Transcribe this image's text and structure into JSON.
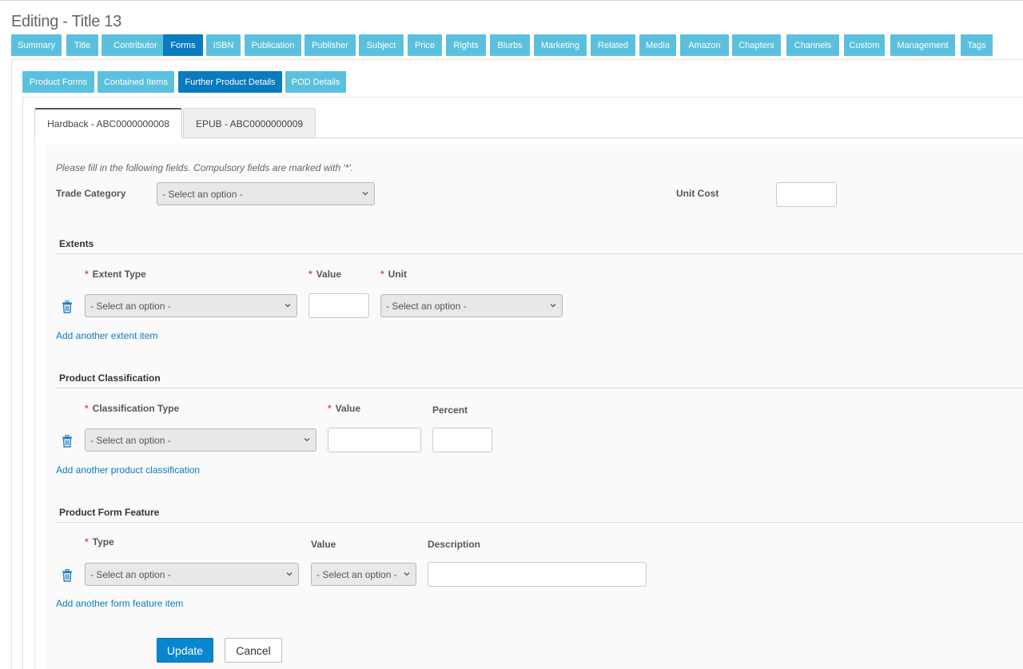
{
  "page": {
    "title": "Editing - Title 13"
  },
  "topnav": {
    "tabs": [
      {
        "label": "Summary"
      },
      {
        "label": "Title"
      },
      {
        "label": "Contributor"
      },
      {
        "label": "Forms"
      },
      {
        "label": "ISBN"
      },
      {
        "label": "Publication"
      },
      {
        "label": "Publisher"
      },
      {
        "label": "Subject"
      },
      {
        "label": "Price"
      },
      {
        "label": "Rights"
      },
      {
        "label": "Blurbs"
      },
      {
        "label": "Marketing"
      },
      {
        "label": "Related"
      },
      {
        "label": "Media"
      },
      {
        "label": "Amazon"
      },
      {
        "label": "Chapters"
      },
      {
        "label": "Channels"
      },
      {
        "label": "Custom"
      },
      {
        "label": "Management"
      },
      {
        "label": "Tags"
      }
    ],
    "active": "Forms"
  },
  "subnav": {
    "tabs": [
      {
        "label": "Product Forms"
      },
      {
        "label": "Contained Items"
      },
      {
        "label": "Further Product Details"
      },
      {
        "label": "POD Details"
      }
    ],
    "active": "Further Product Details"
  },
  "variant_tabs": {
    "active": "Hardback - ABC0000000008",
    "inactive": "EPUB - ABC0000000009"
  },
  "form": {
    "hint": "Please fill in the following fields. Compulsory fields are marked with '*'.",
    "required_marker": "*",
    "trade_category": {
      "label": "Trade Category",
      "value": "- Select an option -"
    },
    "unit_cost": {
      "label": "Unit Cost",
      "value": ""
    }
  },
  "extents": {
    "title": "Extents",
    "extent_type_label": "Extent Type",
    "value_label": "Value",
    "unit_label": "Unit",
    "extent_type_value": "- Select an option -",
    "value": "",
    "unit_value": "- Select an option -",
    "add_link": "Add another extent item"
  },
  "classification": {
    "title": "Product Classification",
    "type_label": "Classification Type",
    "value_label": "Value",
    "percent_label": "Percent",
    "type_value": "- Select an option -",
    "add_link": "Add another product classification"
  },
  "form_feature": {
    "title": "Product Form Feature",
    "type_label": "Type",
    "value_label": "Value",
    "description_label": "Description",
    "type_value": "- Select an option -",
    "value_value": "- Select an option -",
    "add_link": "Add another form feature item"
  },
  "actions": {
    "update": "Update",
    "cancel": "Cancel"
  },
  "colors": {
    "tab": "#5bc0de",
    "tab_active": "#0a7bbf",
    "link": "#0a7bbf",
    "required": "#d9534f",
    "primary_button": "#0a85d0"
  },
  "icons": {
    "delete": "trash-icon",
    "dropdown": "chevron-down-icon"
  }
}
